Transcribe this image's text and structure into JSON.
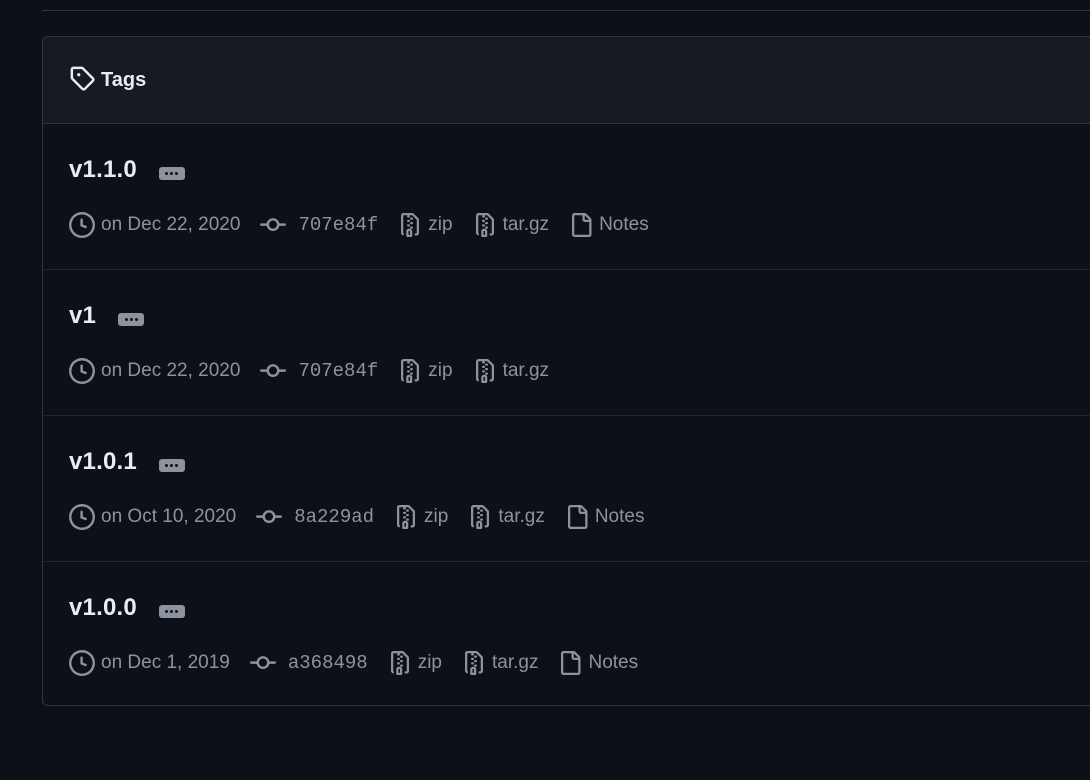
{
  "tags_panel": {
    "title": "Tags"
  },
  "tags": [
    {
      "name": "v1.1.0",
      "date": "on Dec 22, 2020",
      "commit": "707e84f",
      "zip": "zip",
      "targz": "tar.gz",
      "notes": "Notes",
      "has_notes": true
    },
    {
      "name": "v1",
      "date": "on Dec 22, 2020",
      "commit": "707e84f",
      "zip": "zip",
      "targz": "tar.gz",
      "notes": "",
      "has_notes": false
    },
    {
      "name": "v1.0.1",
      "date": "on Oct 10, 2020",
      "commit": "8a229ad",
      "zip": "zip",
      "targz": "tar.gz",
      "notes": "Notes",
      "has_notes": true
    },
    {
      "name": "v1.0.0",
      "date": "on Dec 1, 2019",
      "commit": "a368498",
      "zip": "zip",
      "targz": "tar.gz",
      "notes": "Notes",
      "has_notes": true
    }
  ],
  "icons": {
    "header": "tag-icon",
    "date": "clock-icon",
    "commit": "git-commit-icon",
    "zip": "file-zip-icon",
    "targz": "file-zip-icon",
    "notes": "file-icon",
    "menu": "kebab-horizontal-icon"
  },
  "colors": {
    "background": "#0d1117",
    "header_bg": "#161b22",
    "border": "#30363d",
    "text": "#e6edf3",
    "muted": "#8b949e"
  }
}
